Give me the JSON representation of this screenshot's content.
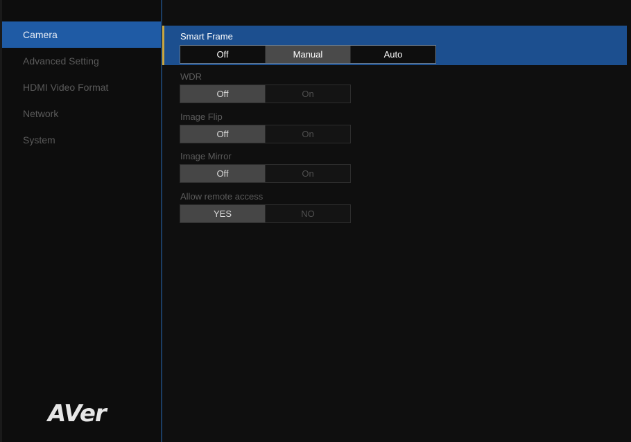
{
  "sidebar": {
    "items": [
      {
        "label": "Camera"
      },
      {
        "label": "Advanced Setting"
      },
      {
        "label": "HDMI Video Format"
      },
      {
        "label": "Network"
      },
      {
        "label": "System"
      }
    ],
    "active_index": 0
  },
  "logo": {
    "text": "AVer"
  },
  "settings": {
    "smart_frame": {
      "label": "Smart Frame",
      "options": [
        "Off",
        "Manual",
        "Auto"
      ],
      "selected": "Manual"
    },
    "wdr": {
      "label": "WDR",
      "options": [
        "Off",
        "On"
      ],
      "selected": "Off"
    },
    "image_flip": {
      "label": "Image Flip",
      "options": [
        "Off",
        "On"
      ],
      "selected": "Off"
    },
    "image_mirror": {
      "label": "Image Mirror",
      "options": [
        "Off",
        "On"
      ],
      "selected": "Off"
    },
    "remote_access": {
      "label": "Allow remote access",
      "options": [
        "YES",
        "NO"
      ],
      "selected": "YES"
    }
  },
  "colors": {
    "accent": "#1f5ba5",
    "highlight_band": "#1c4f8f",
    "focus_edge": "#c9a640"
  }
}
